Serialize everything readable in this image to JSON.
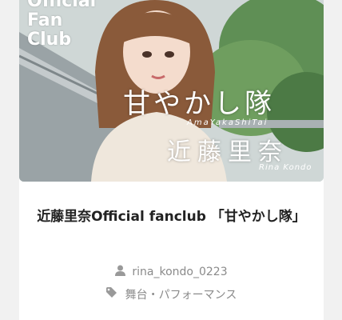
{
  "banner": {
    "overlay_official": "Official",
    "overlay_fan": "Fan",
    "overlay_club": "Club",
    "overlay_title": "甘やかし隊",
    "overlay_romaji": "AmaYakaShiTai",
    "overlay_name": "近藤里奈",
    "overlay_name_romaji": "Rina Kondo"
  },
  "post": {
    "title": "近藤里奈Official fanclub 「甘やかし隊」",
    "author": "rina_kondo_0223",
    "category": "舞台・パフォーマンス"
  },
  "icons": {
    "author": "user-icon",
    "category": "tag-icon"
  },
  "colors": {
    "title": "#222222",
    "meta": "#8a8a8a",
    "background": "#f1f1f1"
  }
}
